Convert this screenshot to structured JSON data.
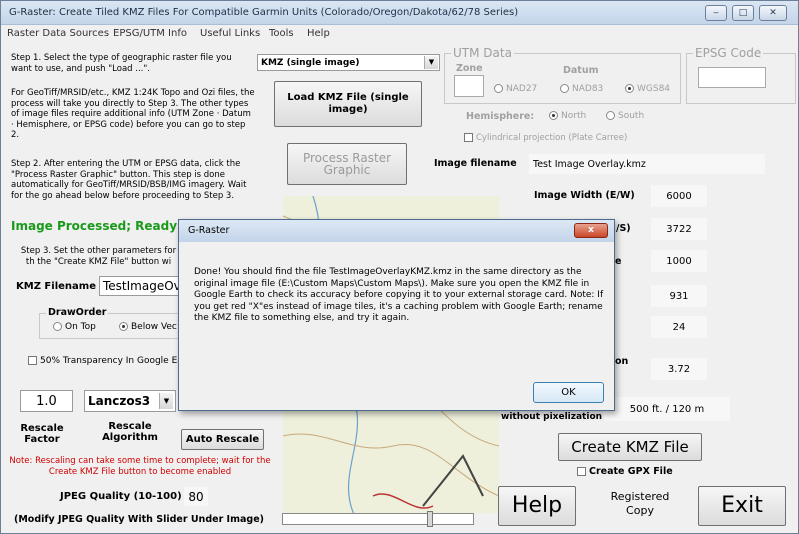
{
  "window": {
    "title": "G-Raster: Create Tiled KMZ Files For Compatible Garmin Units (Colorado/Oregon/Dakota/62/78 Series)",
    "controls": [
      "minimize-icon",
      "maximize-icon",
      "close-icon"
    ]
  },
  "menu": [
    "Raster Data Sources",
    "EPSG/UTM Info",
    "Useful Links",
    "Tools",
    "Help"
  ],
  "step1": {
    "text": "Step 1. Select the type of geographic raster file you want to use, and push \"Load ...\".",
    "text2": "For GeoTiff/MRSID/etc., KMZ 1:24K Topo and Ozi files, the process will take you directly to Step 3. The other types of image files require additional info (UTM Zone · Datum · Hemisphere, or EPSG code) before you can go to step 2.",
    "type_select": "KMZ (single image)",
    "load_button": "Load KMZ File (single image)"
  },
  "step2": {
    "text": "Step 2. After entering the UTM or EPSG data, click the \"Process Raster Graphic\" button.  This step is done automatically for GeoTiff/MRSID/BSB/IMG imagery. Wait for the go ahead below before proceeding to Step 3.",
    "process_button": "Process Raster Graphic"
  },
  "status": "Image Processed; Ready F",
  "step3": {
    "text": "Step 3. Set the other parameters for th the \"Create KMZ File\" button wi"
  },
  "kmz_filename": {
    "label": "KMZ Filename",
    "value": "TestImageOve"
  },
  "draw_order": {
    "label": "DrawOrder",
    "options": [
      "On Top",
      "Below Vec"
    ],
    "selected": "Below Vec"
  },
  "transparency": "50% Transparency In Google Ea",
  "rescale": {
    "factor": "1.0",
    "algorithm": "Lanczos3",
    "factor_label": "Rescale Factor",
    "algorithm_label": "Rescale Algorithm",
    "auto_button": "Auto Rescale",
    "note": "Note: Rescaling can take some time to complete; wait for the Create KMZ File button to become enabled"
  },
  "jpeg": {
    "label": "JPEG Quality (10-100)",
    "value": "80",
    "hint": "(Modify JPEG Quality With Slider Under Image)"
  },
  "utm": {
    "title": "UTM Data",
    "zone_label": "Zone",
    "datum_label": "Datum",
    "datums": [
      "NAD27",
      "NAD83",
      "WGS84"
    ],
    "hemisphere_label": "Hemisphere:",
    "hemispheres": [
      "North",
      "South"
    ],
    "cylindrical": "Cylindrical projection (Plate Carree)"
  },
  "epsg": {
    "title": "EPSG Code"
  },
  "image": {
    "filename_label": "Image filename",
    "filename": "Test  Image Overlay.kmz",
    "width_label": "Image Width (E/W)",
    "width": "6000",
    "height_label_tail": "/S)",
    "height": "3722",
    "v3_tail": "e",
    "v3": "1000",
    "v4": "931",
    "v5": "24",
    "v6_tail": "on",
    "v6": "3.72",
    "pixel_label": "without pixelization",
    "pixel_value": "500 ft. / 120 m"
  },
  "create_button": "Create KMZ File",
  "create_gpx": "Create GPX File",
  "help_button": "Help",
  "registered": "Registered Copy",
  "exit_button": "Exit",
  "dialog": {
    "title": "G-Raster",
    "message": "Done! You should find the file TestImageOverlayKMZ.kmz in the same directory as the original image file (E:\\Custom Maps\\Custom Maps\\). Make sure you open the KMZ file in Google Earth to check its accuracy before copying it to your external storage card. Note: If you get red \"X\"es instead of image tiles, it's a caching problem with Google Earth; rename the KMZ file to something else, and try it again.",
    "ok": "OK",
    "close": "x"
  },
  "colors": {
    "status_green": "#1a9a1a",
    "note_red": "#d00000",
    "dialog_title_bar": "#c3d4ea"
  }
}
